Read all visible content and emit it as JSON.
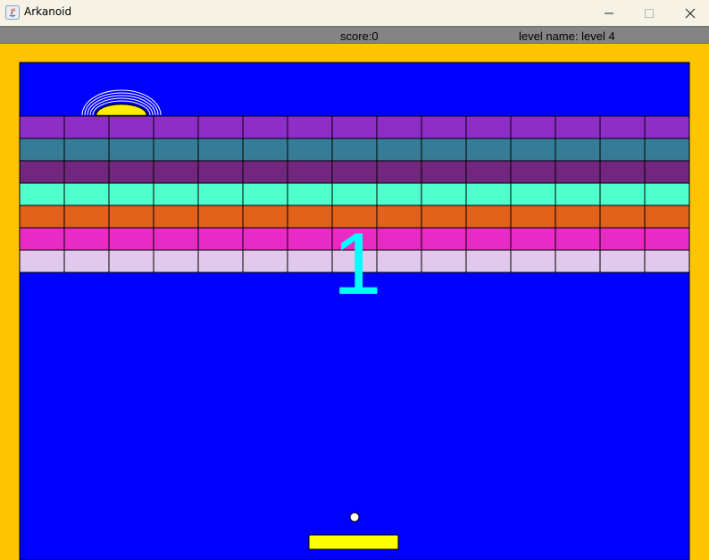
{
  "window": {
    "title": "Arkanoid",
    "icons": [
      "java-app-icon",
      "minimize-icon",
      "maximize-icon",
      "close-icon"
    ]
  },
  "status": {
    "score_text": "score:0",
    "level_text": "level name: level 4"
  },
  "game": {
    "countdown": "1",
    "colors": {
      "background": "#0000ff",
      "border": "#ffc400",
      "paddle": "#ffff00",
      "ball": "#ffffff",
      "countdown": "#00ffff",
      "sun": "#ffee00"
    },
    "block_rows": [
      {
        "color": "#8e2ec7",
        "count": 15
      },
      {
        "color": "#367c97",
        "count": 15
      },
      {
        "color": "#73267d",
        "count": 15
      },
      {
        "color": "#50ffcc",
        "count": 15
      },
      {
        "color": "#e2611b",
        "count": 15
      },
      {
        "color": "#e82bc5",
        "count": 15
      },
      {
        "color": "#e1c9ed",
        "count": 15
      }
    ]
  }
}
